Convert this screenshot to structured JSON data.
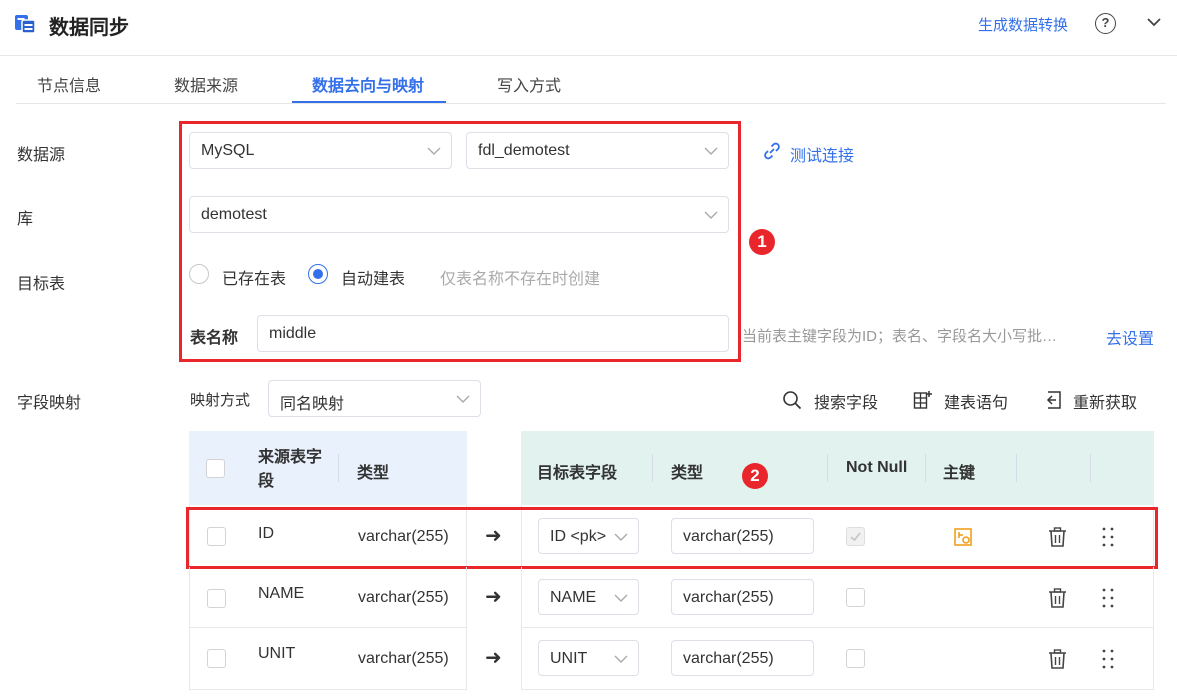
{
  "header": {
    "title": "数据同步",
    "generate_link": "生成数据转换",
    "help_glyph": "?"
  },
  "tabs": [
    {
      "label": "节点信息"
    },
    {
      "label": "数据来源"
    },
    {
      "label": "数据去向与映射",
      "active": true
    },
    {
      "label": "写入方式"
    }
  ],
  "form": {
    "datasource_label": "数据源",
    "datasource_type": "MySQL",
    "datasource_conn": "fdl_demotest",
    "test_connection": "测试连接",
    "db_label": "库",
    "db_value": "demotest",
    "target_label": "目标表",
    "radio_existing": "已存在表",
    "radio_auto": "自动建表",
    "radio_selected": "自动建表",
    "auto_hint": "仅表名称不存在时创建",
    "table_name_label": "表名称",
    "table_name_value": "middle",
    "table_hint": "当前表主键字段为ID；表名、字段名大小写批…",
    "goto_settings": "去设置"
  },
  "mapping": {
    "label": "字段映射",
    "mode_label": "映射方式",
    "mode_value": "同名映射",
    "search_field": "搜索字段",
    "create_stmt": "建表语句",
    "refetch": "重新获取"
  },
  "table": {
    "headers": {
      "source_field": "来源表字段",
      "source_type": "类型",
      "target_field": "目标表字段",
      "target_type": "类型",
      "not_null": "Not Null",
      "primary_key": "主键"
    },
    "rows": [
      {
        "source_field": "ID",
        "source_type": "varchar(255)",
        "target_field": "ID <pk>",
        "target_type": "varchar(255)",
        "not_null": true,
        "primary_key": true
      },
      {
        "source_field": "NAME",
        "source_type": "varchar(255)",
        "target_field": "NAME",
        "target_type": "varchar(255)",
        "not_null": false,
        "primary_key": false
      },
      {
        "source_field": "UNIT",
        "source_type": "varchar(255)",
        "target_field": "UNIT",
        "target_type": "varchar(255)",
        "not_null": false,
        "primary_key": false
      }
    ]
  },
  "annotations": {
    "badge1": "1",
    "badge2": "2",
    "highlight_color": "#e8262b"
  },
  "colors": {
    "accent": "#3370e9",
    "source_header_bg": "#e9f1fd",
    "target_header_bg": "#e2f3ef",
    "pk_icon": "#f0a020"
  }
}
